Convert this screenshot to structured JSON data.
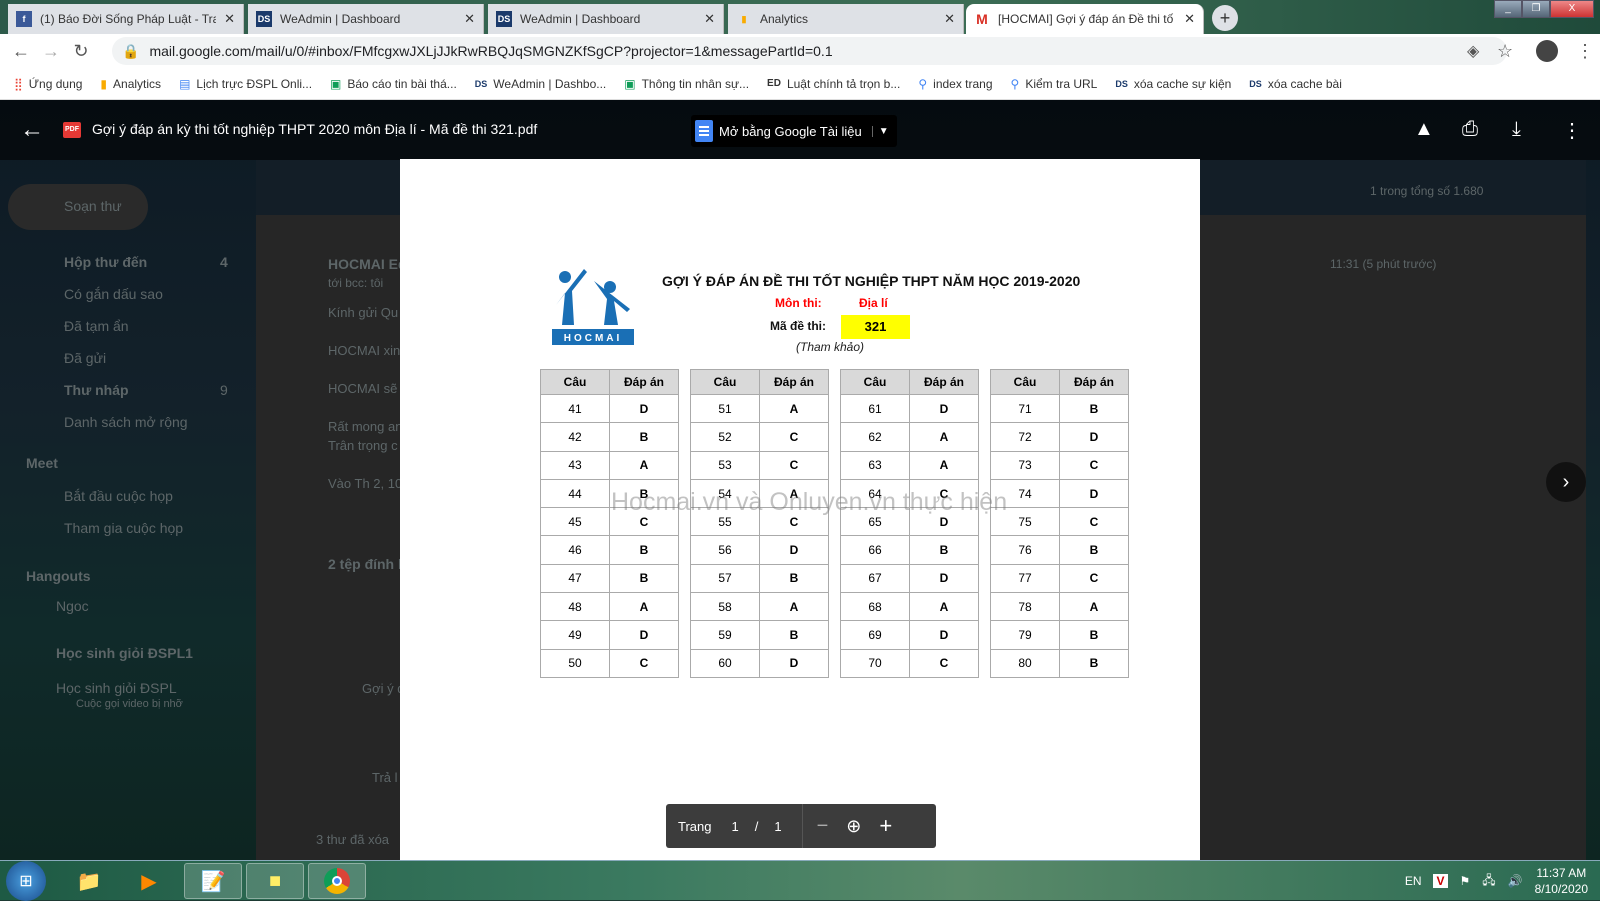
{
  "browser": {
    "tabs": [
      {
        "title": "(1) Báo Đời Sống Pháp Luật - Tra",
        "icon": "facebook-icon"
      },
      {
        "title": "WeAdmin | Dashboard",
        "icon": "dspl-icon"
      },
      {
        "title": "WeAdmin | Dashboard",
        "icon": "dspl-icon"
      },
      {
        "title": "Analytics",
        "icon": "analytics-icon"
      },
      {
        "title": "[HOCMAI] Gợi ý đáp án Đề thi tố",
        "icon": "gmail-icon",
        "active": true
      }
    ],
    "url": "mail.google.com/mail/u/0/#inbox/FMfcgxwJXLjJJkRwRBQJqSMGNZKfSgCP?projector=1&messagePartId=0.1",
    "bookmarks": [
      "Ứng dụng",
      "Analytics",
      "Lịch trực ĐSPL Onli...",
      "Báo cáo tin bài thá...",
      "WeAdmin | Dashbo...",
      "Thông tin nhân sự...",
      "Luật chính tả trọn b...",
      "index trang",
      "Kiểm tra URL",
      "xóa cache sự kiện",
      "xóa cache bài"
    ]
  },
  "gmail": {
    "compose": "Soạn thư",
    "nav": [
      {
        "label": "Hộp thư đến",
        "count": "4"
      },
      {
        "label": "Có gắn dấu sao"
      },
      {
        "label": "Đã tạm ẩn"
      },
      {
        "label": "Đã gửi"
      },
      {
        "label": "Thư nháp",
        "count": "9"
      },
      {
        "label": "Danh sách mở rộng"
      }
    ],
    "meet_heading": "Meet",
    "meet": [
      "Bắt đầu cuộc họp",
      "Tham gia cuộc họp"
    ],
    "hangouts_heading": "Hangouts",
    "hangouts_user": "Ngoc",
    "chats": [
      "Học sinh giỏi ĐSPL1",
      "Học sinh giỏi ĐSPL"
    ],
    "chat_sub": "Cuộc gọi video bị nhỡ",
    "count": "1 trong tổng số 1.680",
    "sender": "HOCMAI Ed",
    "to": "tới bcc: tôi",
    "body": [
      "Kính gửi Qu",
      "HOCMAI xin",
      "HOCMAI sẽ",
      "Rất mong an",
      "Trân trọng c",
      "Vào Th 2, 10"
    ],
    "time": "11:31 (5 phút trước)",
    "attachments": "2 tệp đính k",
    "attachment_name": "Gợi ý đ",
    "reply": "Trả l",
    "deleted": "3 thư đã xóa"
  },
  "viewer": {
    "title": "Gợi ý đáp án kỳ thi tốt nghiệp THPT 2020 môn Địa lí - Mã đề thi 321.pdf",
    "open_with": "Mở bằng Google Tài liệu",
    "pager": {
      "label": "Trang",
      "current": "1",
      "sep": "/",
      "total": "1"
    }
  },
  "document": {
    "logo_text": "HOCMAI",
    "title": "GỢI Ý ĐÁP ÁN ĐỀ THI TỐT NGHIỆP THPT NĂM HỌC 2019-2020",
    "subject_label": "Môn thi:",
    "subject": "Địa lí",
    "code_label": "Mã đề thi:",
    "code": "321",
    "note": "(Tham khảo)",
    "col_q": "Câu",
    "col_a": "Đáp án",
    "watermark": "Hocmai.vn và Onluyen.vn thực hiện",
    "tables": [
      {
        "q": [
          "41",
          "42",
          "43",
          "44",
          "45",
          "46",
          "47",
          "48",
          "49",
          "50"
        ],
        "a": [
          "D",
          "B",
          "A",
          "B",
          "C",
          "B",
          "B",
          "A",
          "D",
          "C"
        ]
      },
      {
        "q": [
          "51",
          "52",
          "53",
          "54",
          "55",
          "56",
          "57",
          "58",
          "59",
          "60"
        ],
        "a": [
          "A",
          "C",
          "C",
          "A",
          "C",
          "D",
          "B",
          "A",
          "B",
          "D"
        ]
      },
      {
        "q": [
          "61",
          "62",
          "63",
          "64",
          "65",
          "66",
          "67",
          "68",
          "69",
          "70"
        ],
        "a": [
          "D",
          "A",
          "A",
          "C",
          "D",
          "B",
          "D",
          "A",
          "D",
          "C"
        ]
      },
      {
        "q": [
          "71",
          "72",
          "73",
          "74",
          "75",
          "76",
          "77",
          "78",
          "79",
          "80"
        ],
        "a": [
          "B",
          "D",
          "C",
          "D",
          "C",
          "B",
          "C",
          "A",
          "B",
          "B"
        ]
      }
    ]
  },
  "taskbar": {
    "lang": "EN",
    "time": "11:37 AM",
    "date": "8/10/2020"
  },
  "colors": {
    "hocmai_blue": "#1a6fb5",
    "subject_red": "#ff0000",
    "code_highlight": "#ffff00"
  }
}
